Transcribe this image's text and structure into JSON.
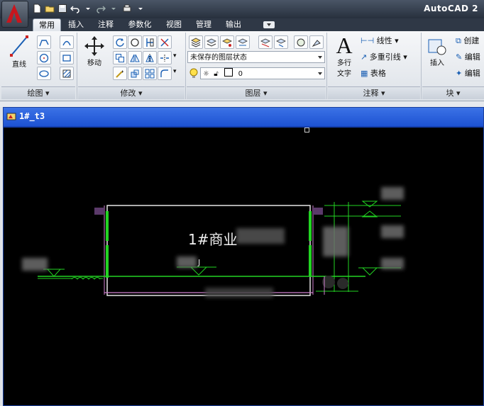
{
  "app": {
    "title": "AutoCAD 2"
  },
  "tabs": [
    "常用",
    "插入",
    "注释",
    "参数化",
    "视图",
    "管理",
    "输出"
  ],
  "ribbon": {
    "draw": {
      "line_label": "直线",
      "title": "绘图"
    },
    "modify": {
      "move_label": "移动",
      "title": "修改"
    },
    "layers": {
      "layer_state": "未保存的图层状态",
      "current_layer": "0",
      "title": "图层"
    },
    "annotation": {
      "mtext_label_1": "多行",
      "mtext_label_2": "文字",
      "linear_label": "线性",
      "multileader_label": "多重引线",
      "table_label": "表格",
      "title": "注释"
    },
    "block": {
      "insert_label": "插入",
      "create_label": "创建",
      "edit_label": "编辑",
      "edit_attr_label": "编辑",
      "title": "块"
    }
  },
  "document": {
    "title": "1#_t3"
  },
  "drawing": {
    "building_label": "1#商业",
    "label_j": "J"
  },
  "colors": {
    "model_bg": "#000000",
    "green": "#22d422",
    "white_line": "#e6e6e6",
    "magenta": "#d080d0",
    "doc_title_blue": "#1d52d2"
  }
}
